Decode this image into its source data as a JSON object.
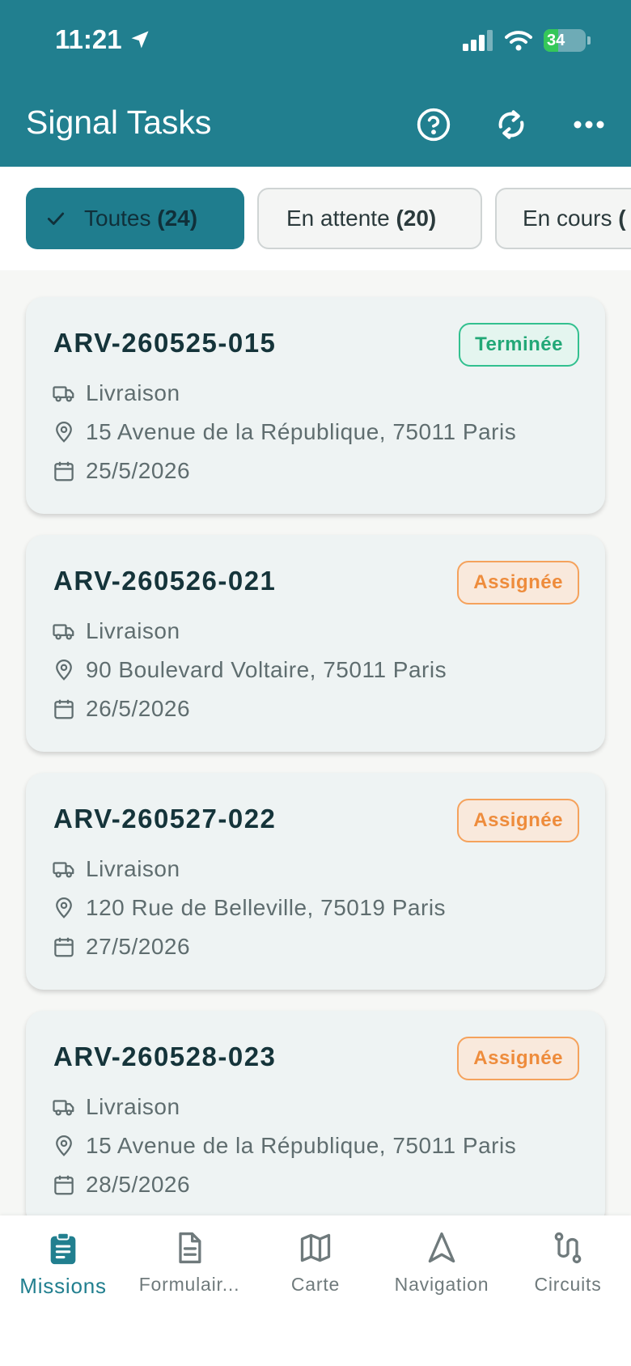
{
  "status_bar": {
    "time": "11:21",
    "battery": "34",
    "battery_level": 0.34
  },
  "app_bar": {
    "title": "Signal Tasks",
    "icons": [
      "help-circle-icon",
      "refresh-icon",
      "more-horizontal-icon"
    ]
  },
  "filters": [
    {
      "label": "Toutes",
      "count": "(24)",
      "active": true
    },
    {
      "label": "En attente",
      "count": "(20)",
      "active": false
    },
    {
      "label": "En cours",
      "count": "(",
      "active": false
    }
  ],
  "missions": [
    {
      "id": "ARV-260525-015",
      "status": "Terminée",
      "type": "Livraison",
      "address": "15 Avenue de la République, 75011 Paris",
      "date": "25/5/2026"
    },
    {
      "id": "ARV-260526-021",
      "status": "Assignée",
      "type": "Livraison",
      "address": "90 Boulevard Voltaire, 75011 Paris",
      "date": "26/5/2026"
    },
    {
      "id": "ARV-260527-022",
      "status": "Assignée",
      "type": "Livraison",
      "address": "120 Rue de Belleville, 75019 Paris",
      "date": "27/5/2026"
    },
    {
      "id": "ARV-260528-023",
      "status": "Assignée",
      "type": "Livraison",
      "address": "15 Avenue de la République, 75011 Paris",
      "date": "28/5/2026"
    }
  ],
  "nav": [
    {
      "label": "Missions",
      "icon": "clipboard-icon",
      "active": true
    },
    {
      "label": "Formulair...",
      "icon": "document-icon",
      "active": false
    },
    {
      "label": "Carte",
      "icon": "map-icon",
      "active": false
    },
    {
      "label": "Navigation",
      "icon": "navigation-arrow-icon",
      "active": false
    },
    {
      "label": "Circuits",
      "icon": "route-icon",
      "active": false
    }
  ],
  "colors": {
    "primary": "#217f8f",
    "done": "#22a877",
    "assigned": "#ee8c3c"
  }
}
